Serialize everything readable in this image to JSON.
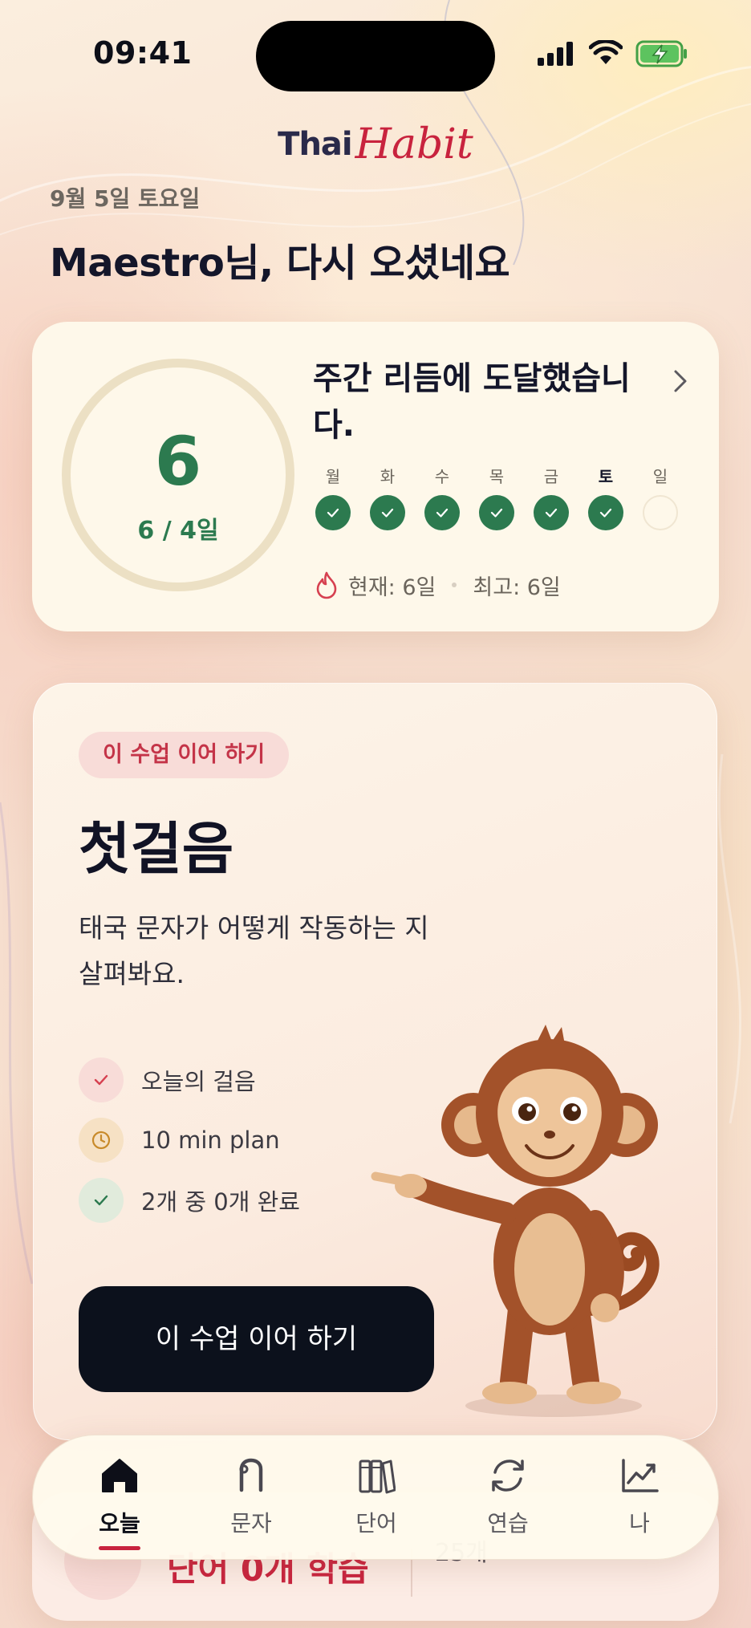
{
  "status": {
    "time": "09:41"
  },
  "logo": {
    "thai": "Thai",
    "habit": "Habit"
  },
  "header": {
    "date": "9월 5일 토요일",
    "greeting": "Maestro님, 다시 오셨네요"
  },
  "streak": {
    "count": "6",
    "goal": "6 / 4일",
    "title": "주간 리듬에 도달했습니다.",
    "days": [
      {
        "label": "월",
        "done": true
      },
      {
        "label": "화",
        "done": true
      },
      {
        "label": "수",
        "done": true
      },
      {
        "label": "목",
        "done": true
      },
      {
        "label": "금",
        "done": true
      },
      {
        "label": "토",
        "done": true,
        "today": true
      },
      {
        "label": "일",
        "done": false
      }
    ],
    "current": "현재: 6일",
    "best": "최고: 6일",
    "accent_color": "#2c7a4f"
  },
  "lesson": {
    "badge": "이 수업 이어 하기",
    "title": "첫걸음",
    "description": "태국 문자가 어떻게 작동하는 지 살펴봐요.",
    "meta": [
      {
        "icon": "check-icon",
        "text": "오늘의 걸음"
      },
      {
        "icon": "clock-icon",
        "text": "10 min plan"
      },
      {
        "icon": "check-icon",
        "text": "2개 중 0개 완료"
      }
    ],
    "cta": "이 수업 이어 하기",
    "mascot": "monkey-mascot"
  },
  "peek": {
    "text": "단어 0개 학습",
    "count": "25개"
  },
  "tabs": [
    {
      "label": "오늘",
      "icon": "home-icon",
      "active": true
    },
    {
      "label": "문자",
      "icon": "thai-letter-icon",
      "active": false
    },
    {
      "label": "단어",
      "icon": "books-icon",
      "active": false
    },
    {
      "label": "연습",
      "icon": "refresh-icon",
      "active": false
    },
    {
      "label": "나",
      "icon": "chart-icon",
      "active": false
    }
  ],
  "colors": {
    "brand_red": "#c8233e",
    "dark": "#0c111c",
    "green": "#2c7a4f"
  }
}
